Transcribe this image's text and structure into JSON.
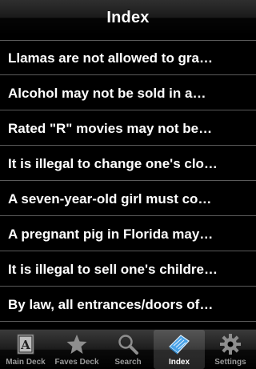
{
  "navbar": {
    "title": "Index"
  },
  "list": {
    "items": [
      "Llamas are not allowed to gra…",
      "Alcohol may not be sold in a…",
      "Rated \"R\" movies may not be…",
      "It is illegal to change one's clo…",
      "A seven-year-old girl must co…",
      "A pregnant pig in Florida may…",
      "It is illegal to sell one's childre…",
      "By law, all entrances/doors of…"
    ]
  },
  "tabbar": {
    "tabs": [
      {
        "label": "Main Deck",
        "icon": "letter-a-card-icon",
        "selected": false
      },
      {
        "label": "Faves Deck",
        "icon": "star-icon",
        "selected": false
      },
      {
        "label": "Search",
        "icon": "magnifier-icon",
        "selected": false
      },
      {
        "label": "Index",
        "icon": "book-icon",
        "selected": true
      },
      {
        "label": "Settings",
        "icon": "gear-icon",
        "selected": false
      }
    ]
  },
  "colors": {
    "accent_blue": "#4aa3e8",
    "inactive_gray": "#9a9a9a"
  }
}
